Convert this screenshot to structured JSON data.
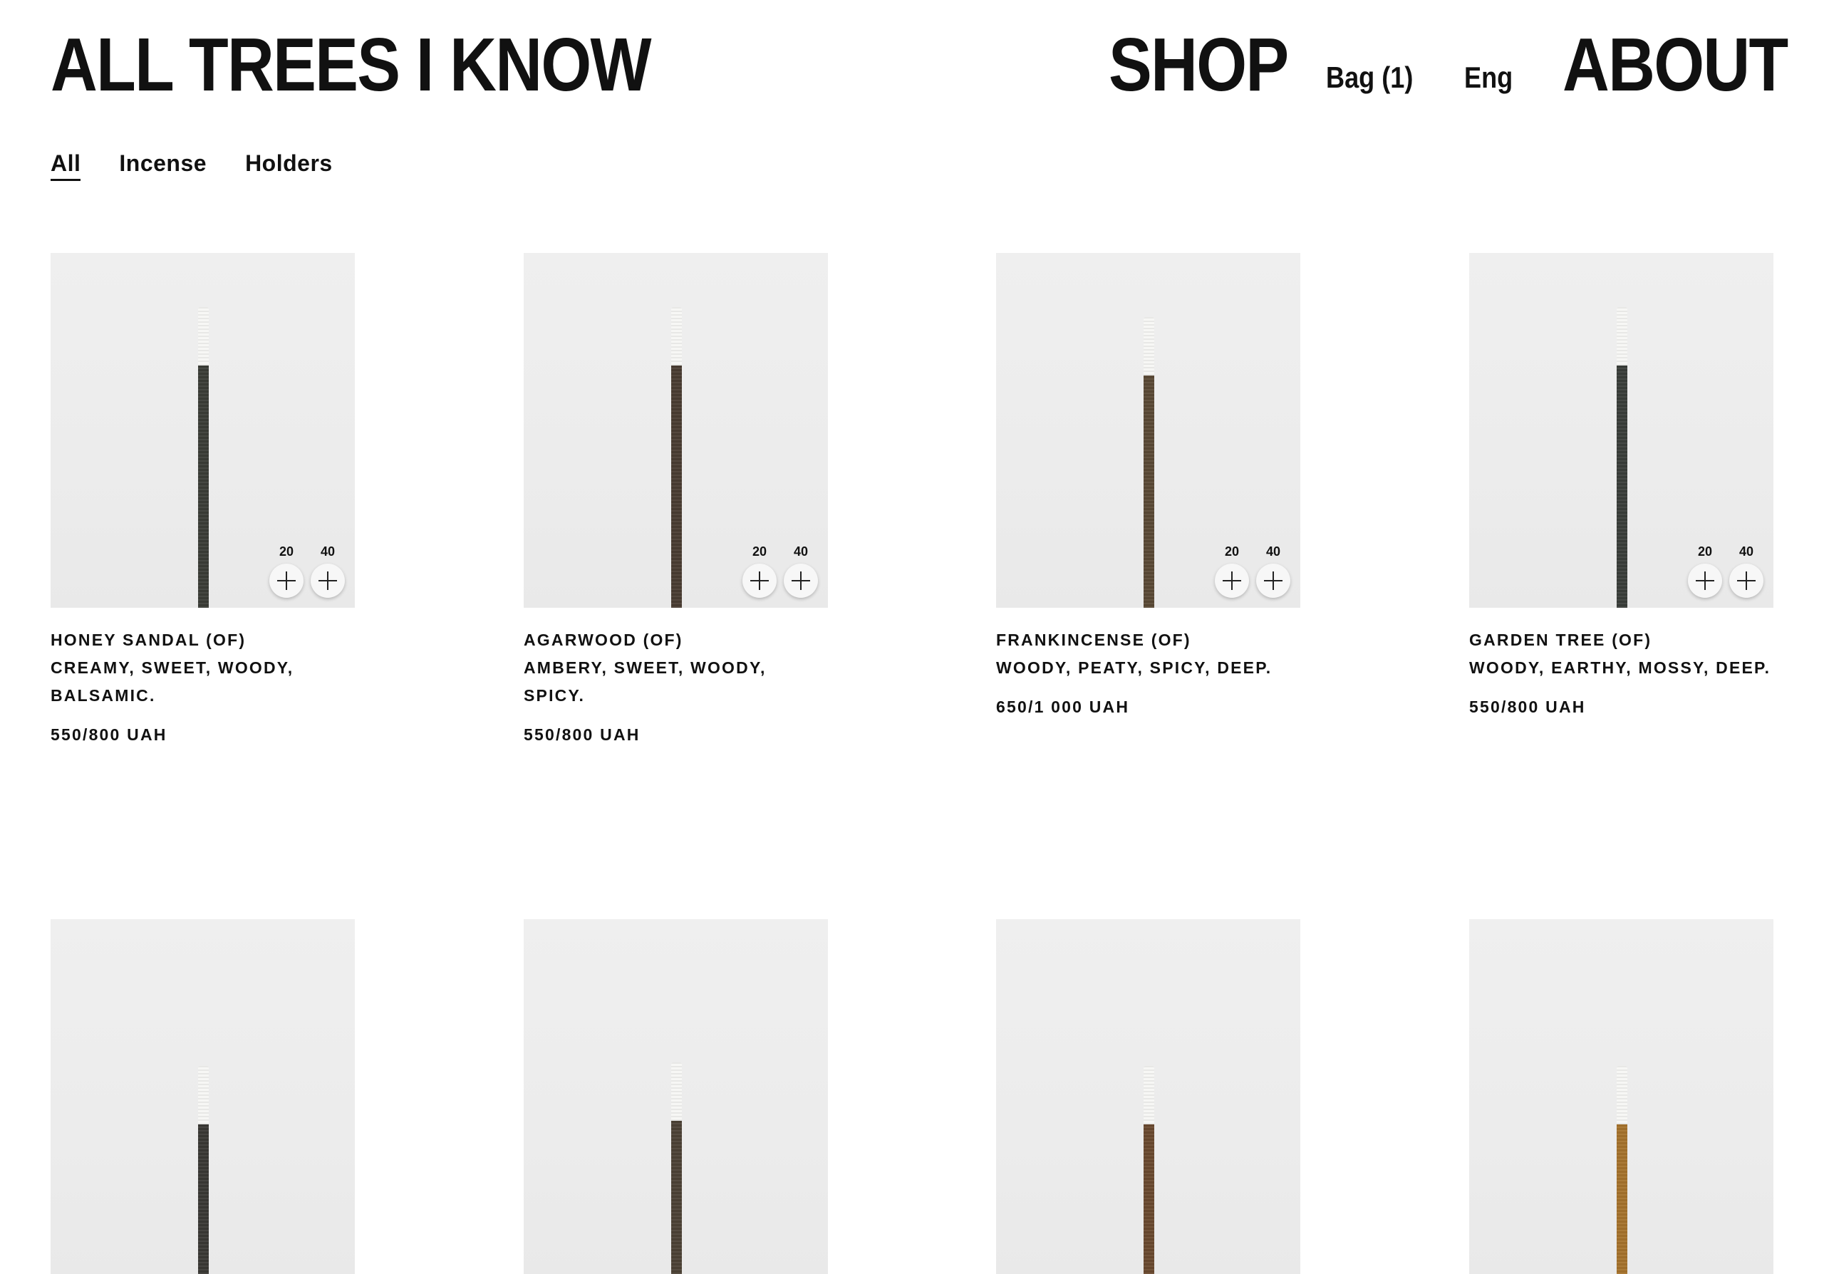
{
  "header": {
    "brand": "ALL TREES I KNOW",
    "shop": "SHOP",
    "bag": "Bag (1)",
    "language": "Eng",
    "about": "ABOUT"
  },
  "filters": {
    "all": "All",
    "incense": "Incense",
    "holders": "Holders",
    "active": "All"
  },
  "icons": {
    "add": "plus-icon"
  },
  "products": [
    {
      "name": "HONEY SANDAL (OF)",
      "notes": "CREAMY, SWEET, WOODY, BALSAMIC.",
      "price": "550/800 UAH",
      "size_small": "20",
      "size_large": "40",
      "stick_color": "#3b3d37"
    },
    {
      "name": "AGARWOOD (OF)",
      "notes": "AMBERY, SWEET, WOODY, SPICY.",
      "price": "550/800 UAH",
      "size_small": "20",
      "size_large": "40",
      "stick_color": "#4a3d32"
    },
    {
      "name": "FRANKINCENSE (OF)",
      "notes": "WOODY, PEATY, SPICY, DEEP.",
      "price": "650/1 000 UAH",
      "size_small": "20",
      "size_large": "40",
      "stick_color": "#5b4a36"
    },
    {
      "name": "GARDEN TREE (OF)",
      "notes": "WOODY, EARTHY, MOSSY, DEEP.",
      "price": "550/800 UAH",
      "size_small": "20",
      "size_large": "40",
      "stick_color": "#3a3e3a"
    },
    {
      "stick_color": "#3a3935"
    },
    {
      "stick_color": "#4d4236"
    },
    {
      "stick_color": "#6a4a2f"
    },
    {
      "stick_color": "#a6732c"
    }
  ]
}
